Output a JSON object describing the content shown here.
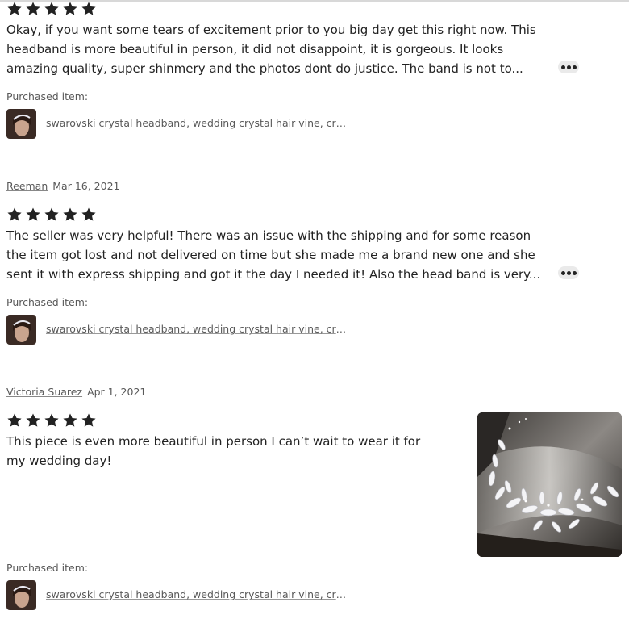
{
  "colors": {
    "text": "#222222",
    "muted": "#595959",
    "star": "#222222",
    "more_button_bg": "#eaeaea"
  },
  "icons": {
    "star": "star-icon",
    "more": "more-dots-icon"
  },
  "reviews": [
    {
      "rating": 5,
      "text": "Okay, if you want some tears of excitement prior to you big day get this right now. This headband is more beautiful in person, it did not disappoint, it is gorgeous. It looks amazing quality, super shinmery and the photos dont do justice. The band is not to...",
      "purchased_label": "Purchased item:",
      "item_title": "swarovski crystal headband, wedding crystal hair vine, crys..."
    },
    {
      "reviewer": "Reeman",
      "date": "Mar 16, 2021",
      "rating": 5,
      "text": "The seller was very helpful! There was an issue with the shipping and for some reason the item got lost and not delivered on time but she made me a brand new one and she sent it with express shipping and got it the day I needed it! Also the head band is very...",
      "purchased_label": "Purchased item:",
      "item_title": "swarovski crystal headband, wedding crystal hair vine, crys..."
    },
    {
      "reviewer": "Victoria Suarez",
      "date": "Apr 1, 2021",
      "rating": 5,
      "text": "This piece is even more beautiful in person I can’t wait to wear it for my wedding day!",
      "purchased_label": "Purchased item:",
      "item_title": "swarovski crystal headband, wedding crystal hair vine, crys..."
    }
  ]
}
